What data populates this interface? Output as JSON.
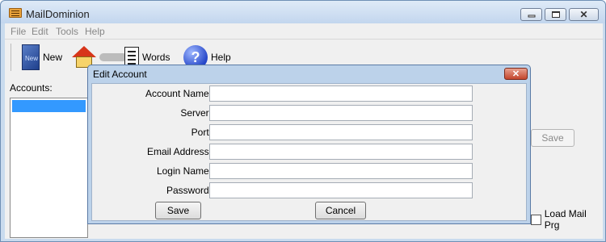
{
  "app": {
    "title": "MailDominion"
  },
  "menu": [
    "File",
    "Edit",
    "Tools",
    "Help"
  ],
  "toolbar": {
    "new_label": "New",
    "words_label": "Words",
    "help_label": "Help",
    "new_icon_text": "New"
  },
  "accounts": {
    "label": "Accounts:"
  },
  "background": {
    "save_label": "Save",
    "load_mail_label": "Load Mail Prg"
  },
  "dialog": {
    "title": "Edit Account",
    "close_glyph": "✕",
    "fields": [
      {
        "label": "Account Name:",
        "value": ""
      },
      {
        "label": "Server:",
        "value": ""
      },
      {
        "label": "Port:",
        "value": ""
      },
      {
        "label": "Email Address:",
        "value": ""
      },
      {
        "label": "Login Name:",
        "value": ""
      },
      {
        "label": "Password:",
        "value": ""
      }
    ],
    "save_label": "Save",
    "cancel_label": "Cancel"
  },
  "colors": {
    "title_bar": "#c2d6ee",
    "selection": "#3399ff",
    "close_button": "#c3452c"
  }
}
